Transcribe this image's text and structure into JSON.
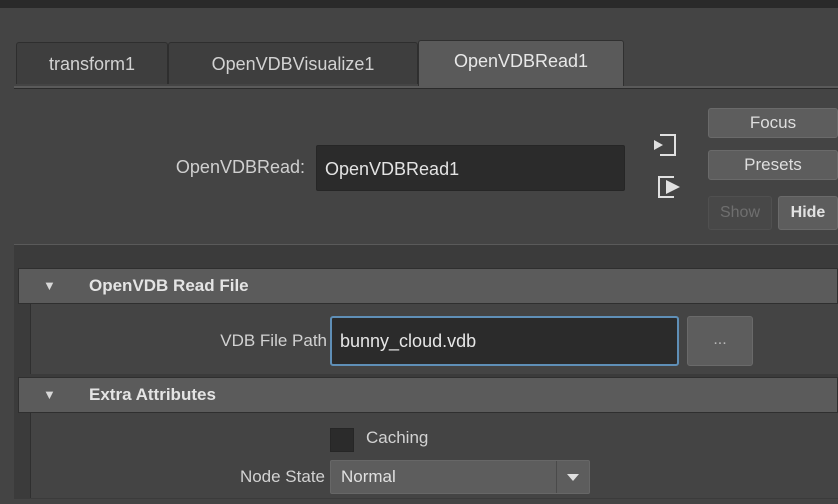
{
  "tabs": [
    {
      "label": "transform1"
    },
    {
      "label": "OpenVDBVisualize1"
    },
    {
      "label": "OpenVDBRead1",
      "active": true
    }
  ],
  "node": {
    "label": "OpenVDBRead:",
    "value": "OpenVDBRead1"
  },
  "buttons": {
    "focus": "Focus",
    "presets": "Presets",
    "show": "Show",
    "hide": "Hide"
  },
  "icons": {
    "input": "input-connection-icon",
    "output": "output-connection-icon"
  },
  "sections": {
    "read_file": {
      "title": "OpenVDB Read File",
      "path_label": "VDB File Path",
      "path_value": "bunny_cloud.vdb",
      "browse_label": "..."
    },
    "extra": {
      "title": "Extra Attributes",
      "caching_label": "Caching",
      "caching_checked": false,
      "node_state_label": "Node State",
      "node_state_value": "Normal"
    }
  },
  "colors": {
    "focus_border": "#5f8fb7",
    "background": "#444444"
  }
}
